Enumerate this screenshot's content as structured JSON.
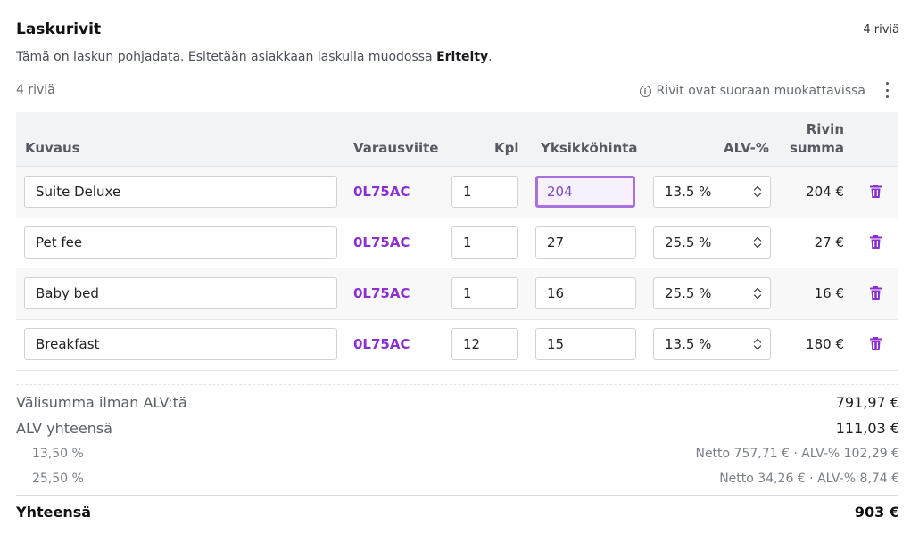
{
  "header": {
    "title": "Laskurivit",
    "row_count_badge": "4 riviä",
    "subtitle_prefix": "Tämä on laskun pohjadata. Esitetään asiakkaan laskulla muodossa ",
    "subtitle_mode": "Eritelty",
    "subtitle_suffix": "."
  },
  "toolbar": {
    "rows_count": "4 riviä",
    "editable_hint": "Rivit ovat suoraan muokattavissa",
    "info_icon": "info-icon",
    "menu_icon": "more-vertical-icon"
  },
  "table": {
    "columns": {
      "description": "Kuvaus",
      "reference": "Varausviite",
      "qty": "Kpl",
      "unit_price": "Yksikköhinta",
      "vat": "ALV-%",
      "row_sum_line1": "Rivin",
      "row_sum_line2": "summa"
    },
    "rows": [
      {
        "description": "Suite Deluxe",
        "reference": "0L75AC",
        "qty": "1",
        "unit_price": "204",
        "vat": "13.5 %",
        "sum": "204 €"
      },
      {
        "description": "Pet fee",
        "reference": "0L75AC",
        "qty": "1",
        "unit_price": "27",
        "vat": "25.5 %",
        "sum": "27 €"
      },
      {
        "description": "Baby bed",
        "reference": "0L75AC",
        "qty": "1",
        "unit_price": "16",
        "vat": "25.5 %",
        "sum": "16 €"
      },
      {
        "description": "Breakfast",
        "reference": "0L75AC",
        "qty": "12",
        "unit_price": "15",
        "vat": "13.5 %",
        "sum": "180 €"
      }
    ],
    "delete_icon": "trash-icon"
  },
  "totals": {
    "subtotal_label": "Välisumma ilman ALV:tä",
    "subtotal_value": "791,97 €",
    "vat_total_label": "ALV yhteensä",
    "vat_total_value": "111,03 €",
    "vat_breakdown": [
      {
        "rate": "13,50 %",
        "detail": "Netto 757,71 € · ALV-% 102,29 €"
      },
      {
        "rate": "25,50 %",
        "detail": "Netto 34,26 € · ALV-% 8,74 €"
      }
    ],
    "grand_total_label": "Yhteensä",
    "grand_total_value": "903 €"
  },
  "colors": {
    "accent": "#8a2fd0",
    "focus_border": "#a970e0"
  }
}
